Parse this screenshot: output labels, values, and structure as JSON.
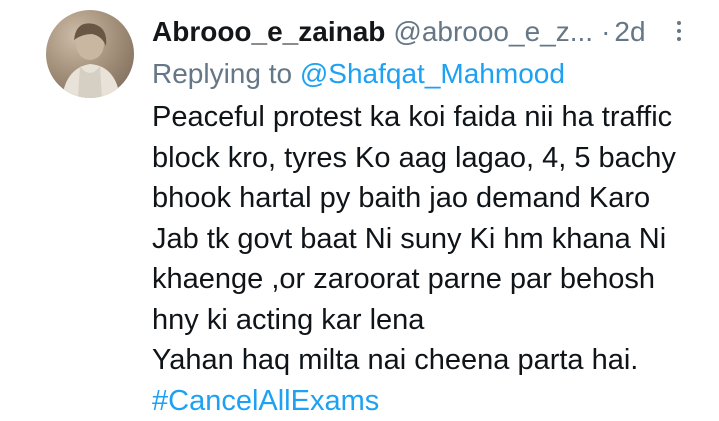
{
  "tweet": {
    "author_name": "Abrooo_e_zainab",
    "author_handle": "@abrooo_e_z...",
    "separator": "·",
    "timestamp": "2d",
    "reply_prefix": "Replying to",
    "reply_to": "@Shafqat_Mahmood",
    "body_lines": [
      "Peaceful protest ka koi faida nii ha traffic",
      "block kro, tyres Ko aag lagao, 4, 5 bachy",
      "bhook hartal py baith jao demand Karo",
      "Jab tk govt baat Ni suny Ki hm khana Ni",
      "khaenge ,or zaroorat parne par behosh",
      "hny ki acting kar lena",
      "Yahan haq milta nai cheena parta hai."
    ],
    "hashtag": "#CancelAllExams",
    "more_icon": "more-vertical-icon",
    "colors": {
      "accent": "#1da1f2",
      "muted": "#657786",
      "text": "#0f1419"
    }
  }
}
